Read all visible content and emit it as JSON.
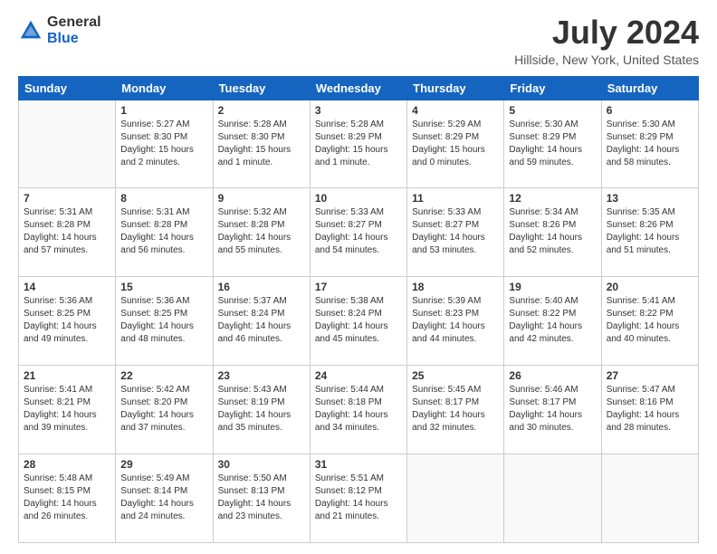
{
  "header": {
    "logo_general": "General",
    "logo_blue": "Blue",
    "title": "July 2024",
    "subtitle": "Hillside, New York, United States"
  },
  "columns": [
    "Sunday",
    "Monday",
    "Tuesday",
    "Wednesday",
    "Thursday",
    "Friday",
    "Saturday"
  ],
  "weeks": [
    [
      {
        "day": "",
        "info": ""
      },
      {
        "day": "1",
        "info": "Sunrise: 5:27 AM\nSunset: 8:30 PM\nDaylight: 15 hours\nand 2 minutes."
      },
      {
        "day": "2",
        "info": "Sunrise: 5:28 AM\nSunset: 8:30 PM\nDaylight: 15 hours\nand 1 minute."
      },
      {
        "day": "3",
        "info": "Sunrise: 5:28 AM\nSunset: 8:29 PM\nDaylight: 15 hours\nand 1 minute."
      },
      {
        "day": "4",
        "info": "Sunrise: 5:29 AM\nSunset: 8:29 PM\nDaylight: 15 hours\nand 0 minutes."
      },
      {
        "day": "5",
        "info": "Sunrise: 5:30 AM\nSunset: 8:29 PM\nDaylight: 14 hours\nand 59 minutes."
      },
      {
        "day": "6",
        "info": "Sunrise: 5:30 AM\nSunset: 8:29 PM\nDaylight: 14 hours\nand 58 minutes."
      }
    ],
    [
      {
        "day": "7",
        "info": "Sunrise: 5:31 AM\nSunset: 8:28 PM\nDaylight: 14 hours\nand 57 minutes."
      },
      {
        "day": "8",
        "info": "Sunrise: 5:31 AM\nSunset: 8:28 PM\nDaylight: 14 hours\nand 56 minutes."
      },
      {
        "day": "9",
        "info": "Sunrise: 5:32 AM\nSunset: 8:28 PM\nDaylight: 14 hours\nand 55 minutes."
      },
      {
        "day": "10",
        "info": "Sunrise: 5:33 AM\nSunset: 8:27 PM\nDaylight: 14 hours\nand 54 minutes."
      },
      {
        "day": "11",
        "info": "Sunrise: 5:33 AM\nSunset: 8:27 PM\nDaylight: 14 hours\nand 53 minutes."
      },
      {
        "day": "12",
        "info": "Sunrise: 5:34 AM\nSunset: 8:26 PM\nDaylight: 14 hours\nand 52 minutes."
      },
      {
        "day": "13",
        "info": "Sunrise: 5:35 AM\nSunset: 8:26 PM\nDaylight: 14 hours\nand 51 minutes."
      }
    ],
    [
      {
        "day": "14",
        "info": "Sunrise: 5:36 AM\nSunset: 8:25 PM\nDaylight: 14 hours\nand 49 minutes."
      },
      {
        "day": "15",
        "info": "Sunrise: 5:36 AM\nSunset: 8:25 PM\nDaylight: 14 hours\nand 48 minutes."
      },
      {
        "day": "16",
        "info": "Sunrise: 5:37 AM\nSunset: 8:24 PM\nDaylight: 14 hours\nand 46 minutes."
      },
      {
        "day": "17",
        "info": "Sunrise: 5:38 AM\nSunset: 8:24 PM\nDaylight: 14 hours\nand 45 minutes."
      },
      {
        "day": "18",
        "info": "Sunrise: 5:39 AM\nSunset: 8:23 PM\nDaylight: 14 hours\nand 44 minutes."
      },
      {
        "day": "19",
        "info": "Sunrise: 5:40 AM\nSunset: 8:22 PM\nDaylight: 14 hours\nand 42 minutes."
      },
      {
        "day": "20",
        "info": "Sunrise: 5:41 AM\nSunset: 8:22 PM\nDaylight: 14 hours\nand 40 minutes."
      }
    ],
    [
      {
        "day": "21",
        "info": "Sunrise: 5:41 AM\nSunset: 8:21 PM\nDaylight: 14 hours\nand 39 minutes."
      },
      {
        "day": "22",
        "info": "Sunrise: 5:42 AM\nSunset: 8:20 PM\nDaylight: 14 hours\nand 37 minutes."
      },
      {
        "day": "23",
        "info": "Sunrise: 5:43 AM\nSunset: 8:19 PM\nDaylight: 14 hours\nand 35 minutes."
      },
      {
        "day": "24",
        "info": "Sunrise: 5:44 AM\nSunset: 8:18 PM\nDaylight: 14 hours\nand 34 minutes."
      },
      {
        "day": "25",
        "info": "Sunrise: 5:45 AM\nSunset: 8:17 PM\nDaylight: 14 hours\nand 32 minutes."
      },
      {
        "day": "26",
        "info": "Sunrise: 5:46 AM\nSunset: 8:17 PM\nDaylight: 14 hours\nand 30 minutes."
      },
      {
        "day": "27",
        "info": "Sunrise: 5:47 AM\nSunset: 8:16 PM\nDaylight: 14 hours\nand 28 minutes."
      }
    ],
    [
      {
        "day": "28",
        "info": "Sunrise: 5:48 AM\nSunset: 8:15 PM\nDaylight: 14 hours\nand 26 minutes."
      },
      {
        "day": "29",
        "info": "Sunrise: 5:49 AM\nSunset: 8:14 PM\nDaylight: 14 hours\nand 24 minutes."
      },
      {
        "day": "30",
        "info": "Sunrise: 5:50 AM\nSunset: 8:13 PM\nDaylight: 14 hours\nand 23 minutes."
      },
      {
        "day": "31",
        "info": "Sunrise: 5:51 AM\nSunset: 8:12 PM\nDaylight: 14 hours\nand 21 minutes."
      },
      {
        "day": "",
        "info": ""
      },
      {
        "day": "",
        "info": ""
      },
      {
        "day": "",
        "info": ""
      }
    ]
  ]
}
